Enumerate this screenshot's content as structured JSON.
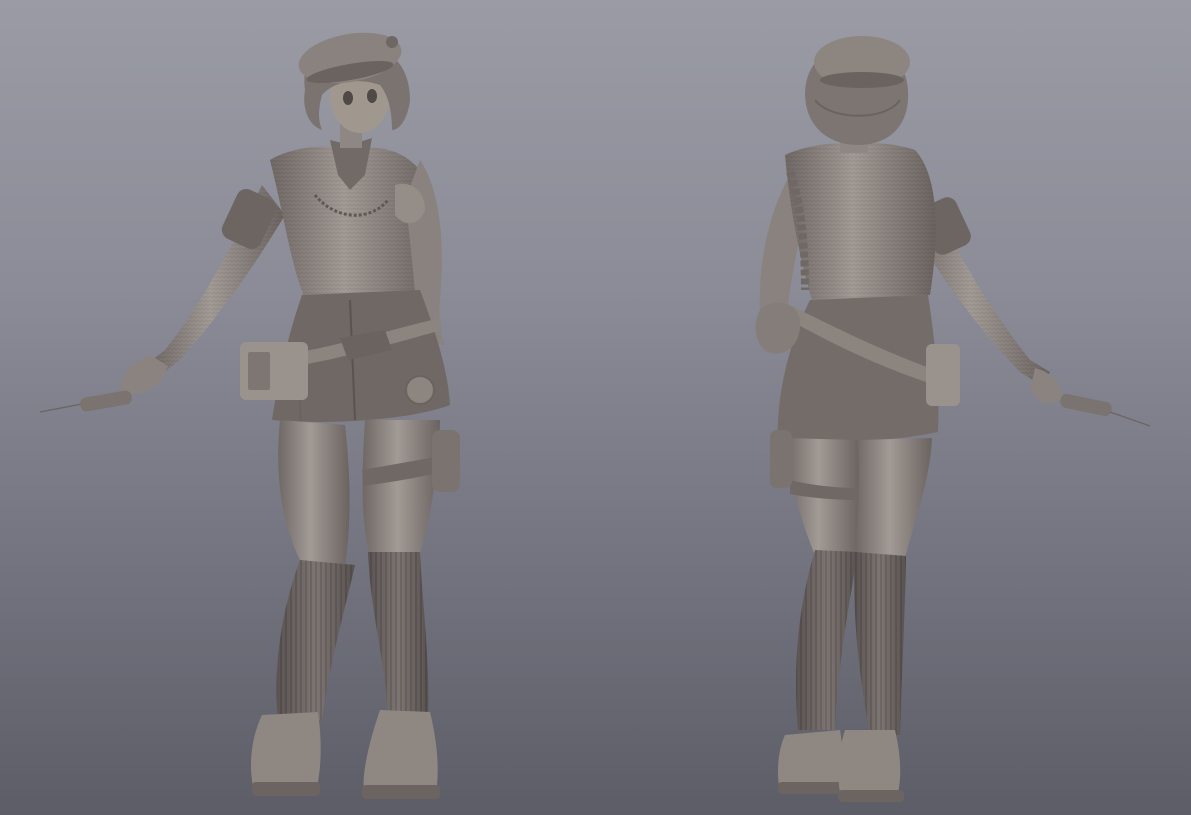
{
  "scene": {
    "views": [
      {
        "name": "front-view"
      },
      {
        "name": "back-view"
      }
    ],
    "colors": {
      "background_top": "#9a9ba5",
      "background_bottom": "#5c5d67",
      "clay_light": "#a29a95",
      "clay_mid": "#857d79",
      "clay_dark": "#5f5856",
      "clay_shadow": "#4a4443"
    }
  }
}
